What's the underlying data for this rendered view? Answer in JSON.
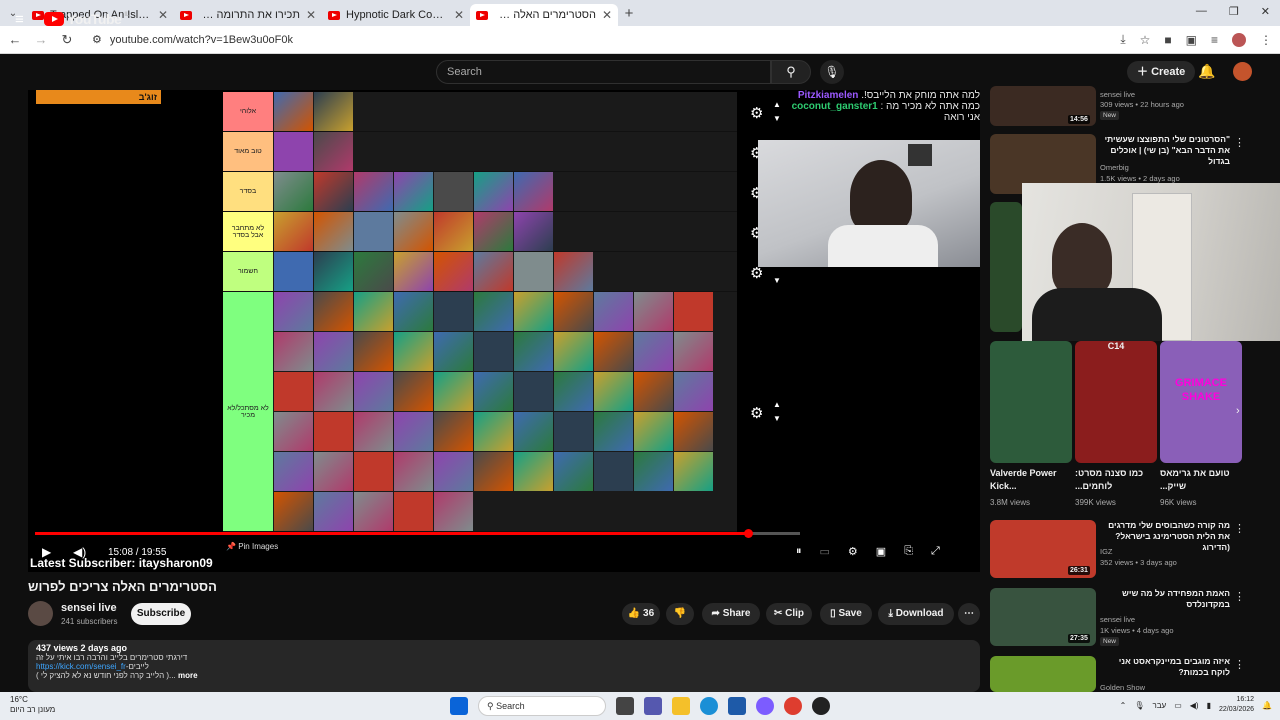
{
  "browser": {
    "tabs": [
      {
        "title": "Trapped On An Island Until I Bu",
        "active": false
      },
      {
        "title": "תכירו את התרומה המושלמת",
        "active": false
      },
      {
        "title": "Hypnotic Dark Code | Futuristic",
        "active": false
      },
      {
        "title": "הסטרימרים האלה צריכים לפרוש",
        "active": true
      }
    ],
    "url": "youtube.com/watch?v=1Bew3u0oF0k"
  },
  "youtube": {
    "logo_text": "YouTube",
    "logo_country": "IL",
    "search_placeholder": "Search",
    "create_label": "Create"
  },
  "player": {
    "banner_text": "זוג'ב",
    "tier_labels": [
      "אלוהי",
      "טוב מאוד",
      "בסדר",
      "לא מתחבר אבל בסדר",
      "חשמור",
      "לא מסתכל/לא מכיר"
    ],
    "tier_colors": [
      "#ff7f7f",
      "#ffbf7f",
      "#ffdf7f",
      "#ffff7f",
      "#bfff7f",
      "#7fff7f"
    ],
    "tier_counts": [
      2,
      2,
      7,
      7,
      8,
      60
    ],
    "chat_line1": "למה אתה מוחק את הלייבס!.",
    "chat_user1": "Pitzkiamelen",
    "chat_user2": "coconut_ganster1",
    "chat_line2": "כמה אתה לא מכיר מה :",
    "chat_line3": "אני רואה",
    "time": "15:08 / 19:55",
    "pin_label": "Pin Images",
    "latest_sub": "Latest Subscriber: itaysharon09",
    "progress": 0.932
  },
  "video": {
    "title": "הסטרימרים האלה צריכים לפרוש",
    "channel": "sensei live",
    "subs": "241 subscribers",
    "subscribe": "Subscribe",
    "likes": "36",
    "share": "Share",
    "clip": "Clip",
    "save": "Save",
    "download": "Download",
    "meta": "437 views  2 days ago",
    "desc1": "דירגתי סטרימרים בלייב והרבה רבו איתי על זה",
    "link": "https://kick.com/sensei_fr",
    "link_suffix": "-לייבים",
    "desc2": "( הלייב קרה לפני חודש נא לא להציק לי )...",
    "more": "more"
  },
  "sidebar": {
    "videos": [
      {
        "title": "",
        "channel": "sensei live",
        "stats": "309 views • 22 hours ago",
        "badge": "New",
        "duration": "14:56",
        "color": "#3b2a22"
      },
      {
        "title": "\"הסרטונים שלי התפוצצו שעשיתי את הדבר הבא\" (בן שי) | אוכלים בגדול",
        "channel": "Omerbig",
        "stats": "1.5K views • 2 days ago",
        "badge": "",
        "duration": "",
        "color": "#4a3626"
      }
    ],
    "shorts": [
      {
        "title": "Valverde Power Kick...",
        "views": "3.8M views",
        "color": "#2d5b3b"
      },
      {
        "title": "כמו סצנה מסרט: לוחמים...",
        "views": "399K views",
        "color": "#8b1d1d"
      },
      {
        "title": "טועם את גרימאס שייק...",
        "views": "96K views",
        "color": "#8a5fb8"
      }
    ],
    "shorts_labels": [
      "C14",
      "GRIMACE SHAKE"
    ],
    "videos2": [
      {
        "title": "מה קורה כשהבוסים שלי מדרגים את הלית הסטרימינג בישראל? (הדירוג",
        "channel": "IGZ",
        "stats": "352 views • 3 days ago",
        "duration": "26:31",
        "color": "#c03a2b"
      },
      {
        "title": "האמת המפחידה על מה שיש במקדונלדס",
        "channel": "sensei live",
        "stats": "1K views • 4 days ago",
        "badge": "New",
        "duration": "27:35",
        "color": "#38533f"
      },
      {
        "title": "איזה מוגבים במיינקראסט אני לוקח בכמות?",
        "channel": "Golden Show",
        "stats": "",
        "duration": "",
        "color": "#6a9b2a"
      }
    ]
  },
  "taskbar": {
    "weather_temp": "16°C",
    "weather_desc": "מעונן רב היום",
    "search": "Search",
    "lang": "עבר",
    "time": "16:12",
    "date": "22/03/2026"
  }
}
